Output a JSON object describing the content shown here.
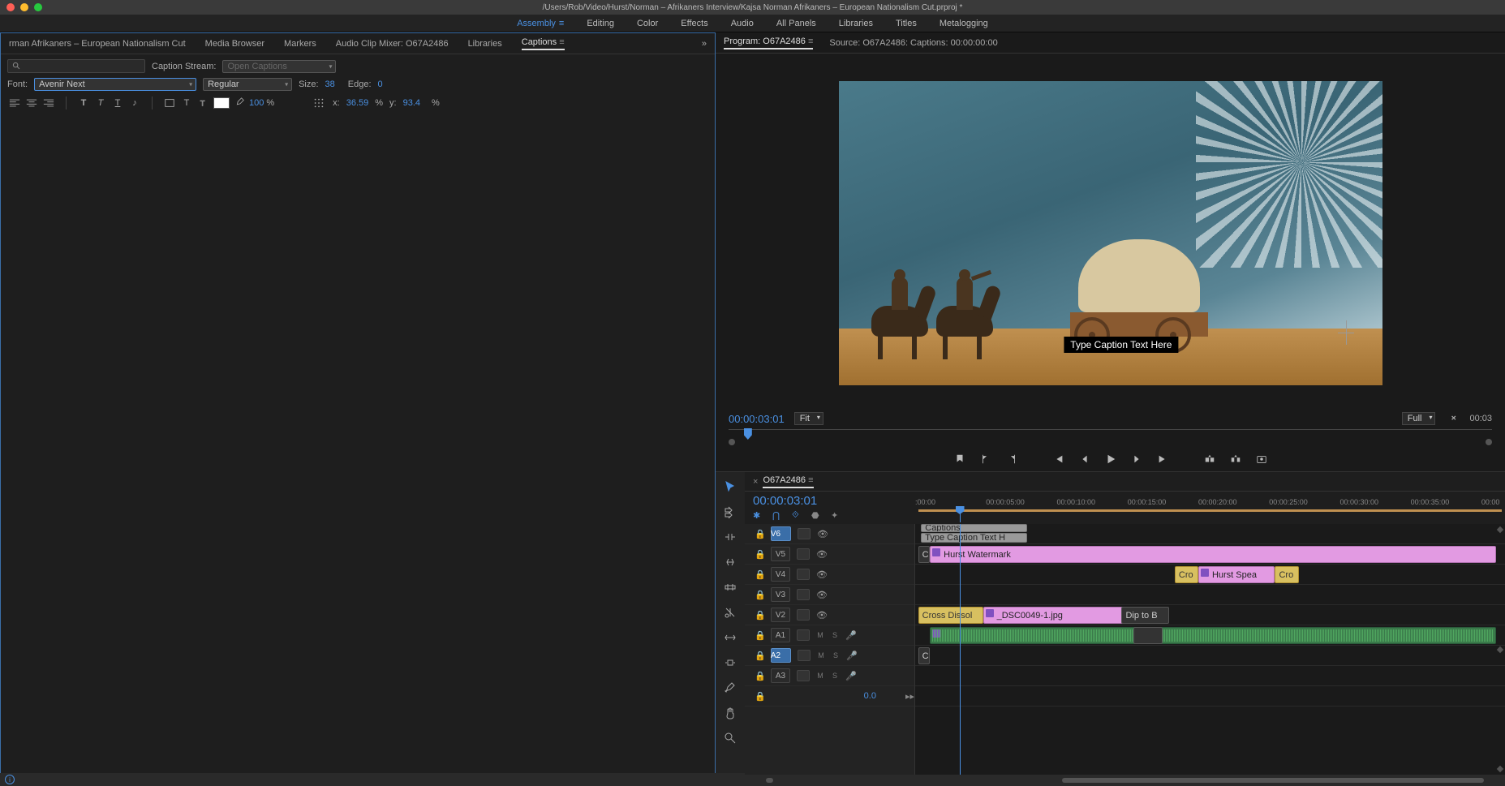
{
  "title": "/Users/Rob/Video/Hurst/Norman – Afrikaners Interview/Kajsa Norman Afrikaners – European Nationalism Cut.prproj *",
  "workspaces": [
    "Assembly",
    "Editing",
    "Color",
    "Effects",
    "Audio",
    "All Panels",
    "Libraries",
    "Titles",
    "Metalogging"
  ],
  "ws_active": 0,
  "left_tabs": [
    "rman Afrikaners – European Nationalism Cut",
    "Media Browser",
    "Markers",
    "Audio Clip Mixer: O67A2486",
    "Libraries",
    "Captions"
  ],
  "left_active": 5,
  "caption_stream_label": "Caption Stream:",
  "caption_stream_value": "Open Captions",
  "font_label": "Font:",
  "font_value": "Avenir Next",
  "font_style": "Regular",
  "size_label": "Size:",
  "size_value": "38",
  "edge_label": "Edge:",
  "edge_value": "0",
  "opacity_value": "100",
  "pct": "%",
  "x_label": "x:",
  "x_value": "36.59",
  "y_label": "y:",
  "y_value": "93.4",
  "program_tab": "Program: O67A2486",
  "source_text": "Source: O67A2486: Captions: 00:00:00:00",
  "caption_overlay": "Type Caption Text Here",
  "monitor_tc": "00:00:03:01",
  "monitor_zoom": "Fit",
  "monitor_res": "Full",
  "monitor_dur": "00:03",
  "sequence_tab": "O67A2486",
  "timeline_tc": "00:00:03:01",
  "ruler_ticks": [
    ":00:00",
    "00:00:05:00",
    "00:00:10:00",
    "00:00:15:00",
    "00:00:20:00",
    "00:00:25:00",
    "00:00:30:00",
    "00:00:35:00",
    "00:00"
  ],
  "tracks_v": [
    "V6",
    "V5",
    "V4",
    "V3",
    "V2"
  ],
  "tracks_a": [
    "A1",
    "A2",
    "A3"
  ],
  "v_selected": "V6",
  "a_selected": "A2",
  "clip_captions": "Captions",
  "clip_caption_txt": "Type Caption Text H",
  "clip_watermark": "Hurst Watermark",
  "clip_speaker": "Hurst Spea",
  "clip_cro1": "Cro",
  "clip_cro2": "Cro",
  "clip_crossdis": "Cross Dissol",
  "clip_img": "_DSC0049-1.jpg",
  "clip_dip": "Dip to B",
  "clip_cr3": "Cr",
  "clip_cr4": "Cr",
  "master_gain": "0.0",
  "ms_m": "M",
  "ms_s": "S"
}
